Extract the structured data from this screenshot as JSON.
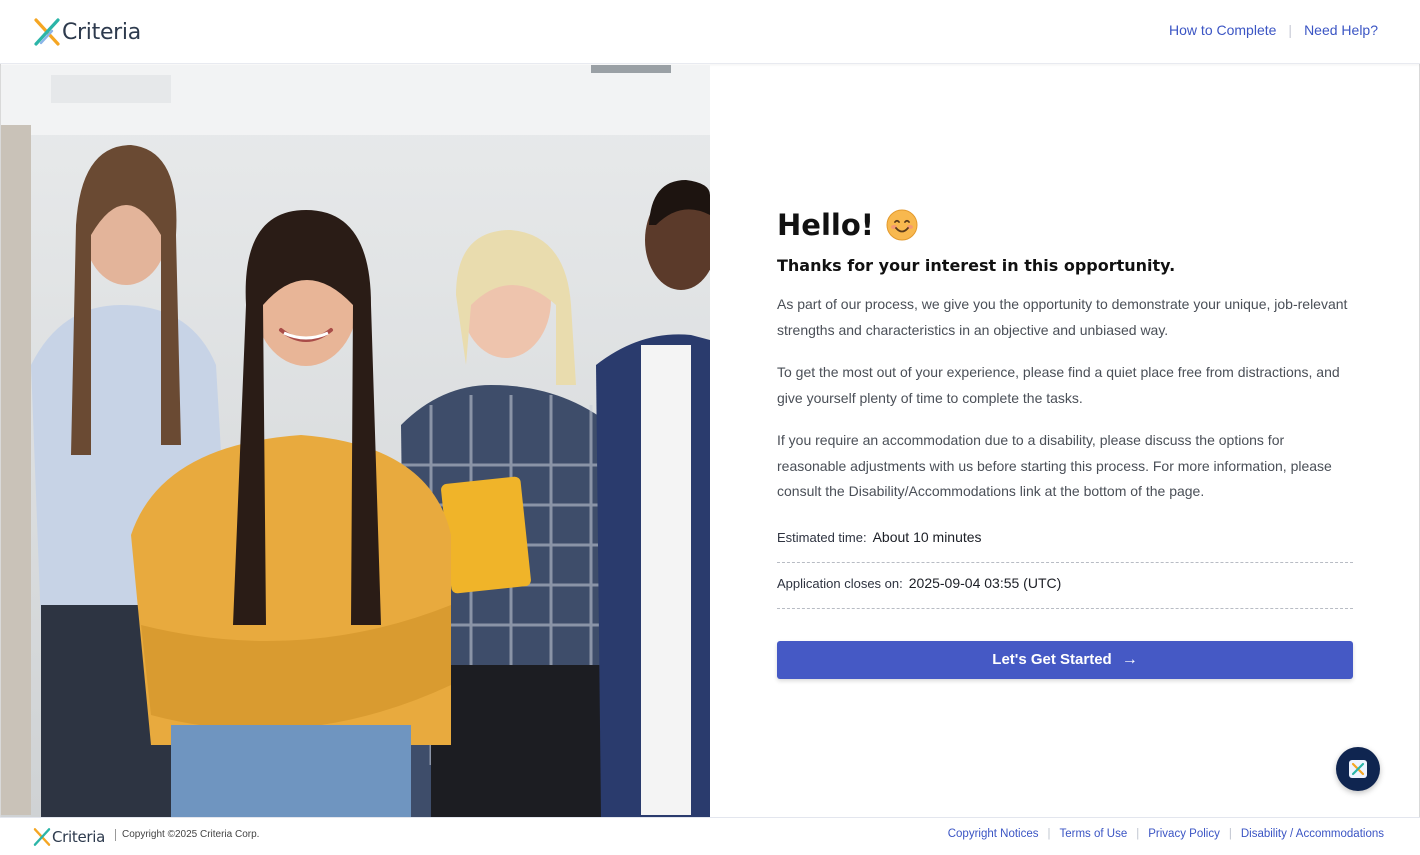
{
  "header": {
    "logo_text": "Criteria",
    "links": {
      "how_to_complete": "How to Complete",
      "need_help": "Need Help?"
    },
    "separator": "|"
  },
  "main": {
    "greeting": "Hello!",
    "subtitle": "Thanks for your interest in this opportunity.",
    "paragraphs": [
      "As part of our process, we give you the opportunity to demonstrate your unique, job-relevant strengths and characteristics in an objective and unbiased way.",
      "To get the most out of your experience, please find a quiet place free from distractions, and give yourself plenty of time to complete the tasks.",
      "If you require an accommodation due to a disability, please discuss the options for reasonable adjustments with us before starting this process. For more information, please consult the Disability/Accommodations link at the bottom of the page."
    ],
    "estimated_time": {
      "label": "Estimated time:",
      "value": "About 10 minutes"
    },
    "closes_on": {
      "label": "Application closes on:",
      "value": "2025-09-04 03:55 (UTC)"
    },
    "cta_label": "Let's Get Started",
    "cta_arrow": "→"
  },
  "footer": {
    "logo_text": "Criteria",
    "copyright": "Copyright ©2025 Criteria Corp.",
    "links": {
      "copyright_notices": "Copyright Notices",
      "terms": "Terms of Use",
      "privacy": "Privacy Policy",
      "accessibility": "Disability / Accommodations"
    },
    "separator": "|"
  },
  "colors": {
    "brand_blue": "#4559c5",
    "link_blue": "#3b55c4",
    "chat_navy": "#0f2550",
    "logo_orange": "#f5a623",
    "logo_teal": "#2bb5a8"
  },
  "icons": {
    "logo": "criteria-x-logo-icon",
    "emoji": "smiling-face-icon",
    "chat": "chat-widget-icon",
    "arrow": "arrow-right-icon"
  }
}
